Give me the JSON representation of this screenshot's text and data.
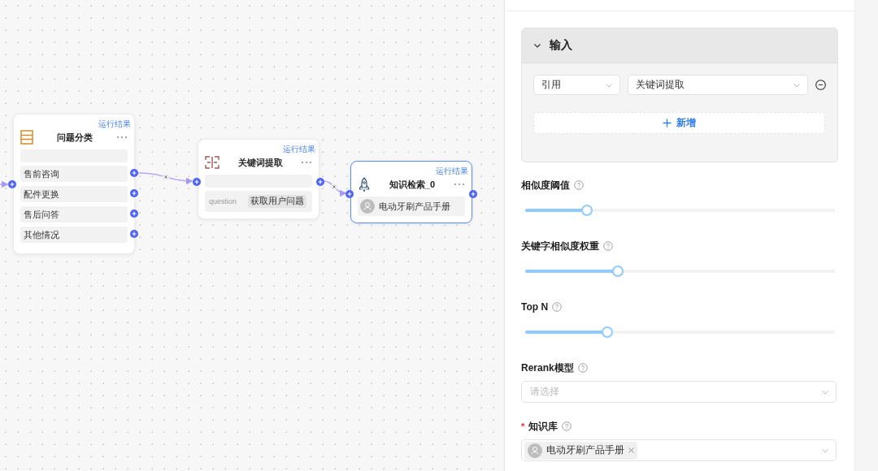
{
  "canvas": {
    "nodes": [
      {
        "kind": "categorize",
        "title": "问题分类",
        "selected": false,
        "result_link": "运行结果",
        "items": [
          "售前咨询",
          "配件更换",
          "售后问答",
          "其他情况"
        ]
      },
      {
        "kind": "keyword",
        "title": "关键词提取",
        "selected": false,
        "result_link": "运行结果",
        "param": {
          "name": "question",
          "value": "获取用户问题"
        }
      },
      {
        "kind": "retrieval",
        "title": "知识检索_0",
        "selected": true,
        "result_link": "运行结果",
        "knowledge_base": "电动牙刷产品手册"
      }
    ]
  },
  "panel": {
    "input": {
      "title": "输入",
      "expanded": true,
      "source_type": "引用",
      "source": "关键词提取",
      "add_button": "新增"
    },
    "sliders": [
      {
        "label": "相似度阈值",
        "level": 0.2
      },
      {
        "label": "关键字相似度权重",
        "level": 0.3
      },
      {
        "label": "Top N",
        "level": 0.265
      }
    ],
    "rerank": {
      "label": "Rerank模型",
      "placeholder": "请选择"
    },
    "knowledge_base": {
      "label": "知识库",
      "required_mark": "*",
      "tags": [
        "电动牙刷产品手册"
      ]
    }
  }
}
